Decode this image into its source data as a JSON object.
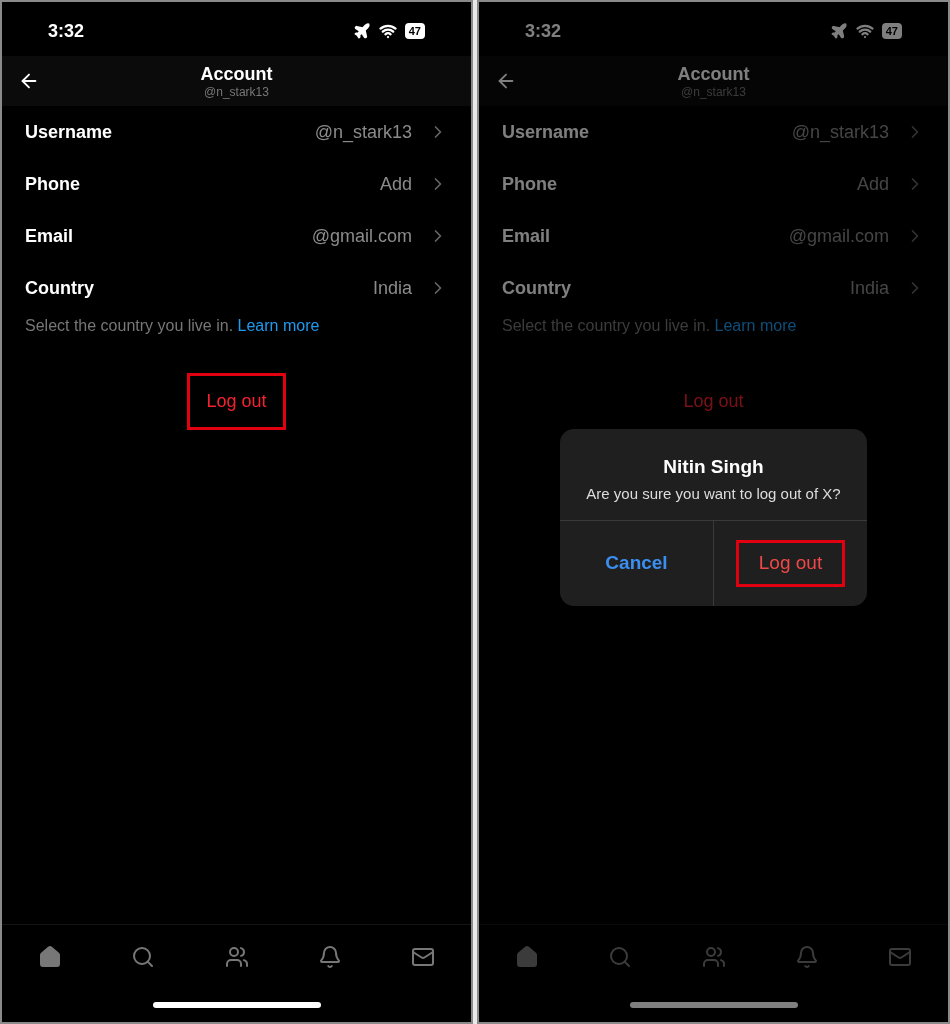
{
  "screens": [
    {
      "status_bar": {
        "time": "3:32",
        "battery": "47"
      },
      "header": {
        "title": "Account",
        "subtitle": "@n_stark13"
      },
      "rows": [
        {
          "label": "Username",
          "value": "@n_stark13"
        },
        {
          "label": "Phone",
          "value": "Add"
        },
        {
          "label": "Email",
          "value": "@gmail.com"
        },
        {
          "label": "Country",
          "value": "India"
        }
      ],
      "hint": {
        "text": "Select the country you live in.",
        "link": "Learn more"
      },
      "logout_button": {
        "label": "Log out",
        "highlighted": true
      },
      "nav": [
        {
          "kind": "home",
          "selected": true
        },
        {
          "kind": "search",
          "selected": false
        },
        {
          "kind": "communities",
          "selected": false
        },
        {
          "kind": "notifications",
          "selected": false
        },
        {
          "kind": "messages",
          "selected": false
        }
      ]
    },
    {
      "status_bar": {
        "time": "3:32",
        "battery": "47"
      },
      "header": {
        "title": "Account",
        "subtitle": "@n_stark13"
      },
      "rows": [
        {
          "label": "Username",
          "value": "@n_stark13"
        },
        {
          "label": "Phone",
          "value": "Add"
        },
        {
          "label": "Email",
          "value": "@gmail.com"
        },
        {
          "label": "Country",
          "value": "India"
        }
      ],
      "hint": {
        "text": "Select the country you live in.",
        "link": "Learn more"
      },
      "logout_button": {
        "label": "Log out",
        "highlighted": false
      },
      "nav": [
        {
          "kind": "home",
          "selected": true
        },
        {
          "kind": "search",
          "selected": false
        },
        {
          "kind": "communities",
          "selected": false
        },
        {
          "kind": "notifications",
          "selected": false
        },
        {
          "kind": "messages",
          "selected": false
        }
      ],
      "dialog": {
        "title": "Nitin Singh",
        "message": "Are you sure you want to log out of X?",
        "buttons": [
          {
            "kind": "cancel",
            "label": "Cancel",
            "highlighted": false
          },
          {
            "kind": "destructive",
            "label": "Log out",
            "highlighted": true
          }
        ]
      }
    }
  ]
}
